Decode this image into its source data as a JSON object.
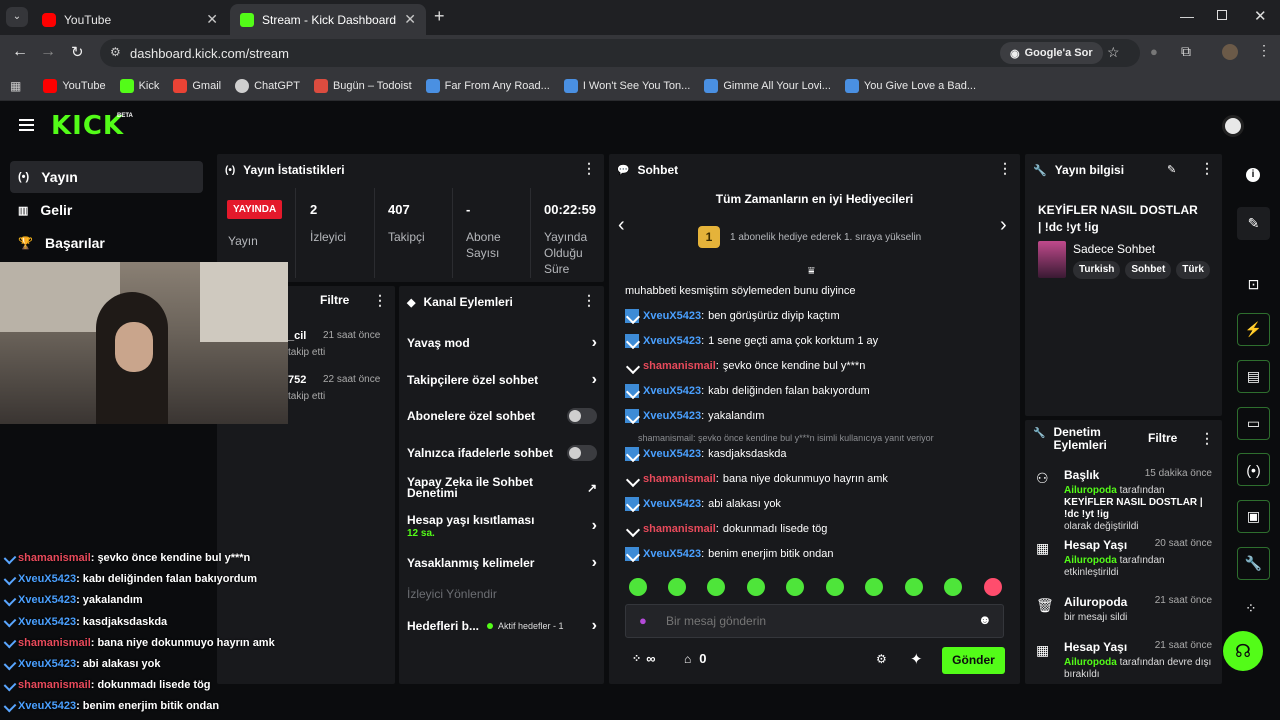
{
  "browser": {
    "tabs": [
      {
        "title": "YouTube"
      },
      {
        "title": "Stream - Kick Dashboard"
      }
    ],
    "url": "dashboard.kick.com/stream",
    "search_chip": "Google'a Sor",
    "bookmarks": [
      {
        "label": "YouTube"
      },
      {
        "label": "Kick"
      },
      {
        "label": "Gmail"
      },
      {
        "label": "ChatGPT"
      },
      {
        "label": "Bugün – Todoist"
      },
      {
        "label": "Far From Any Road..."
      },
      {
        "label": "I Won't See You Ton..."
      },
      {
        "label": "Gimme All Your Lovi..."
      },
      {
        "label": "You Give Love a Bad..."
      }
    ]
  },
  "kick": {
    "logo": "KICK",
    "logo_beta": "BETA",
    "nav": [
      {
        "label": "Yayın",
        "icon": "broadcast-icon"
      },
      {
        "label": "Gelir",
        "icon": "chart-icon"
      },
      {
        "label": "Başarılar",
        "icon": "trophy-icon"
      }
    ]
  },
  "stats": {
    "title": "Yayın İstatistikleri",
    "live_badge": "YAYINDA",
    "items": [
      {
        "value": "",
        "label": "Yayın"
      },
      {
        "value": "2",
        "label": "İzleyici"
      },
      {
        "value": "407",
        "label": "Takipçi"
      },
      {
        "value": "-",
        "label": "Abone Sayısı"
      },
      {
        "value": "00:22:59",
        "label": "Yayında Olduğu Süre"
      }
    ]
  },
  "activity": {
    "filter_label": "Filtre",
    "items": [
      {
        "name": "_cil",
        "time": "21 saat önce",
        "action": "takip etti"
      },
      {
        "name": "752",
        "time": "22 saat önce",
        "action": "takip etti"
      }
    ]
  },
  "channel_actions": {
    "title": "Kanal Eylemleri",
    "rows": [
      {
        "label": "Yavaş mod"
      },
      {
        "label": "Takipçilere özel sohbet"
      },
      {
        "label": "Abonelere özel sohbet"
      },
      {
        "label": "Yalnızca ifadelerle sohbet"
      },
      {
        "label": "Yapay Zeka ile Sohbet Denetimi"
      },
      {
        "label": "Hesap yaşı kısıtlaması",
        "sub": "12 sa."
      },
      {
        "label": "Yasaklanmış kelimeler"
      },
      {
        "label": "İzleyici Yönlendir"
      },
      {
        "label": "Hedefleri b...",
        "sub": "Aktif hedefler - 1"
      }
    ]
  },
  "chat": {
    "title": "Sohbet",
    "gifters_title": "Tüm Zamanların en iyi Hediyecileri",
    "gifters_rank": "1",
    "gifters_text": "1 abonelik hediye ederek 1. sıraya yükselin",
    "partial_message": "muhabbeti kesmiştim söylemeden bunu diyince",
    "messages": [
      {
        "user": "XveuX5423",
        "text": "ben görüşürüz diyip kaçtım",
        "color": "#4aa0ff"
      },
      {
        "user": "XveuX5423",
        "text": "1 sene geçti ama çok korktum 1 ay",
        "color": "#4aa0ff"
      },
      {
        "user": "shamanismail",
        "text": "şevko önce kendine bul y***n",
        "color": "#e84a5b"
      },
      {
        "user": "XveuX5423",
        "text": "kabı deliğinden falan bakıyordum",
        "color": "#4aa0ff"
      },
      {
        "user": "XveuX5423",
        "text": "yakalandım",
        "color": "#4aa0ff"
      },
      {
        "user": "XveuX5423",
        "text": "kasdjaksdaskda",
        "color": "#4aa0ff"
      },
      {
        "user": "shamanismail",
        "text": "bana niye dokunmuyo hayrın amk",
        "color": "#e84a5b"
      },
      {
        "user": "XveuX5423",
        "text": "abi alakası yok",
        "color": "#4aa0ff"
      },
      {
        "user": "shamanismail",
        "text": "dokunmadı lisede tög",
        "color": "#e84a5b"
      },
      {
        "user": "XveuX5423",
        "text": "benim enerjim bitik ondan",
        "color": "#4aa0ff"
      }
    ],
    "reply_note": "shamanismail: şevko önce kendine bul y***n isimli kullanıcıya yanıt veriyor",
    "input_placeholder": "Bir mesaj gönderin",
    "points": "∞",
    "inventory": "0",
    "send_label": "Gönder"
  },
  "stream_info": {
    "title": "Yayın bilgisi",
    "stream_title": "KEYİFLER NASIL DOSTLAR | !dc !yt !ig",
    "category": "Sadece Sohbet",
    "tags": [
      "Turkish",
      "Sohbet",
      "Türk"
    ]
  },
  "moderation": {
    "title": "Denetim Eylemleri",
    "filter_label": "Filtre",
    "items": [
      {
        "title": "Başlık",
        "time": "15 dakika önce",
        "actor": "Ailuropoda",
        "text": "tarafından",
        "detail": "KEYİFLER NASIL DOSTLAR | !dc !yt !ig",
        "suffix": "olarak değiştirildi",
        "icon": "users-icon"
      },
      {
        "title": "Hesap Yaşı",
        "time": "20 saat önce",
        "actor": "Ailuropoda",
        "text": "tarafından etkinleştirildi",
        "icon": "calendar-icon"
      },
      {
        "title": "Ailuropoda",
        "time": "21 saat önce",
        "actor": "",
        "text": "bir mesajı sildi",
        "icon": "trash-icon"
      },
      {
        "title": "Hesap Yaşı",
        "time": "21 saat önce",
        "actor": "Ailuropoda",
        "text": "tarafından devre dışı bırakıldı",
        "icon": "calendar-icon"
      }
    ]
  },
  "overlay_chat": [
    {
      "user": "shamanismail",
      "text": "şevko önce kendine bul y***n",
      "color": "#e84a5b"
    },
    {
      "user": "XveuX5423",
      "text": "kabı deliğinden falan bakıyordum",
      "color": "#4aa0ff"
    },
    {
      "user": "XveuX5423",
      "text": "yakalandım",
      "color": "#4aa0ff"
    },
    {
      "user": "XveuX5423",
      "text": "kasdjaksdaskda",
      "color": "#4aa0ff"
    },
    {
      "user": "shamanismail",
      "text": "bana niye dokunmuyo hayrın amk",
      "color": "#e84a5b"
    },
    {
      "user": "XveuX5423",
      "text": "abi alakası yok",
      "color": "#4aa0ff"
    },
    {
      "user": "shamanismail",
      "text": "dokunmadı lisede tög",
      "color": "#e84a5b"
    },
    {
      "user": "XveuX5423",
      "text": "benim enerjim bitik ondan",
      "color": "#4aa0ff"
    }
  ],
  "colors": {
    "kick_green": "#53fc18",
    "live_red": "#e4192b",
    "user_blue": "#4aa0ff",
    "user_red": "#e84a5b"
  }
}
